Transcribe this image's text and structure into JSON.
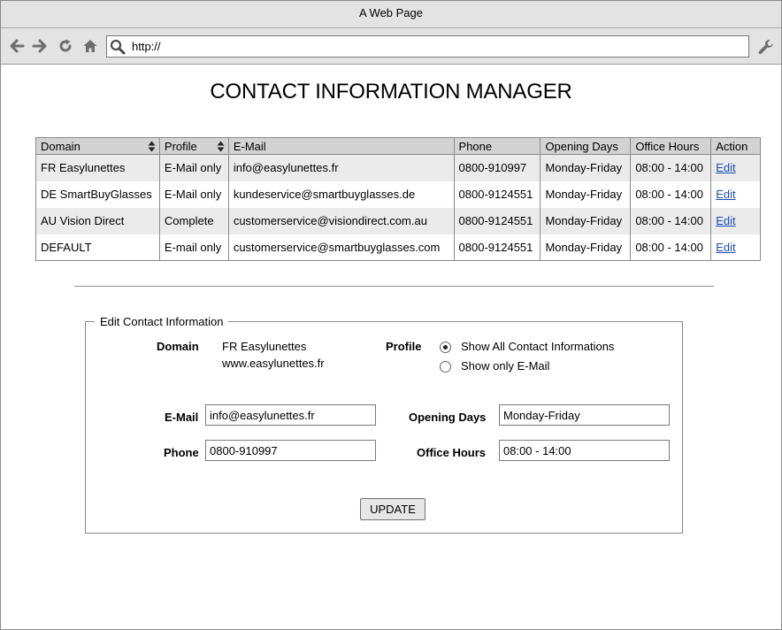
{
  "window": {
    "title": "A Web Page"
  },
  "toolbar": {
    "address": "http://",
    "icons": [
      "back-arrow-icon",
      "forward-arrow-icon",
      "reload-icon",
      "home-icon",
      "search-icon",
      "wrench-icon"
    ]
  },
  "page": {
    "title": "CONTACT INFORMATION MANAGER"
  },
  "table": {
    "headers": [
      "Domain",
      "Profile",
      "E-Mail",
      "Phone",
      "Opening Days",
      "Office Hours",
      "Action"
    ],
    "rows": [
      {
        "domain": "FR Easylunettes",
        "profile": "E-Mail only",
        "email": "info@easylunettes.fr",
        "phone": "0800-910997",
        "days": "Monday-Friday",
        "hours": "08:00 - 14:00",
        "action": "Edit"
      },
      {
        "domain": "DE SmartBuyGlasses",
        "profile": "E-Mail only",
        "email": "kundeservice@smartbuyglasses.de",
        "phone": "0800-9124551",
        "days": "Monday-Friday",
        "hours": "08:00 - 14:00",
        "action": "Edit"
      },
      {
        "domain": "AU Vision Direct",
        "profile": "Complete",
        "email": "customerservice@visiondirect.com.au",
        "phone": "0800-9124551",
        "days": "Monday-Friday",
        "hours": "08:00 - 14:00",
        "action": "Edit"
      },
      {
        "domain": "DEFAULT",
        "profile": "E-mail only",
        "email": "customerservice@smartbuyglasses.com",
        "phone": "0800-9124551",
        "days": "Monday-Friday",
        "hours": "08:00 - 14:00",
        "action": "Edit"
      }
    ]
  },
  "edit": {
    "legend": "Edit Contact Information",
    "domain_label": "Domain",
    "domain_name": "FR Easylunettes",
    "domain_url": "www.easylunettes.fr",
    "profile_label": "Profile",
    "profile_options": [
      "Show All Contact Informations",
      "Show only E-Mail"
    ],
    "profile_selected": "Show All Contact Informations",
    "email_label": "E-Mail",
    "email_value": "info@easylunettes.fr",
    "phone_label": "Phone",
    "phone_value": "0800-910997",
    "days_label": "Opening Days",
    "days_value": "Monday-Friday",
    "hours_label": "Office Hours",
    "hours_value": "08:00 - 14:00",
    "update_label": "UPDATE"
  },
  "colors": {
    "chrome": "#e3e3e3",
    "header": "#d3d3d3",
    "alt_row": "#ebebeb",
    "link": "#1a4db3"
  }
}
